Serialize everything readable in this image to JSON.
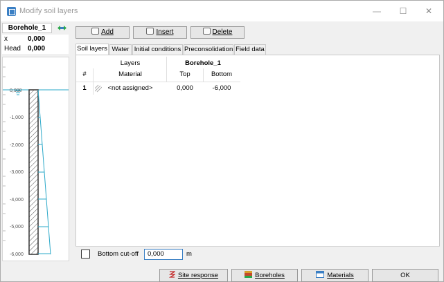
{
  "window": {
    "title": "Modify soil layers",
    "min": "—",
    "max": "☐",
    "close": "✕"
  },
  "borehole": {
    "name": "Borehole_1",
    "x_label": "x",
    "x_value": "0,000",
    "head_label": "Head",
    "head_value": "0,000"
  },
  "axis": {
    "ticks": [
      "0,000",
      "-1,000",
      "-2,000",
      "-3,000",
      "-4,000",
      "-5,000",
      "-6,000"
    ]
  },
  "toolbar": {
    "add_label": "Add",
    "insert_label": "Insert",
    "delete_label": "Delete"
  },
  "tabs": [
    {
      "label": "Soil layers",
      "active": true
    },
    {
      "label": "Water"
    },
    {
      "label": "Initial conditions"
    },
    {
      "label": "Preconsolidation"
    },
    {
      "label": "Field data"
    }
  ],
  "table": {
    "group_layers": "Layers",
    "group_borehole": "Borehole_1",
    "col_num": "#",
    "col_material": "Material",
    "col_top": "Top",
    "col_bottom": "Bottom",
    "rows": [
      {
        "num": "1",
        "material": "<not assigned>",
        "top": "0,000",
        "bottom": "-6,000"
      }
    ]
  },
  "cutoff": {
    "label": "Bottom cut-off",
    "value": "0,000",
    "unit": "m"
  },
  "footer": {
    "site_response": "Site response",
    "boreholes": "Boreholes",
    "materials": "Materials",
    "ok": "OK"
  }
}
